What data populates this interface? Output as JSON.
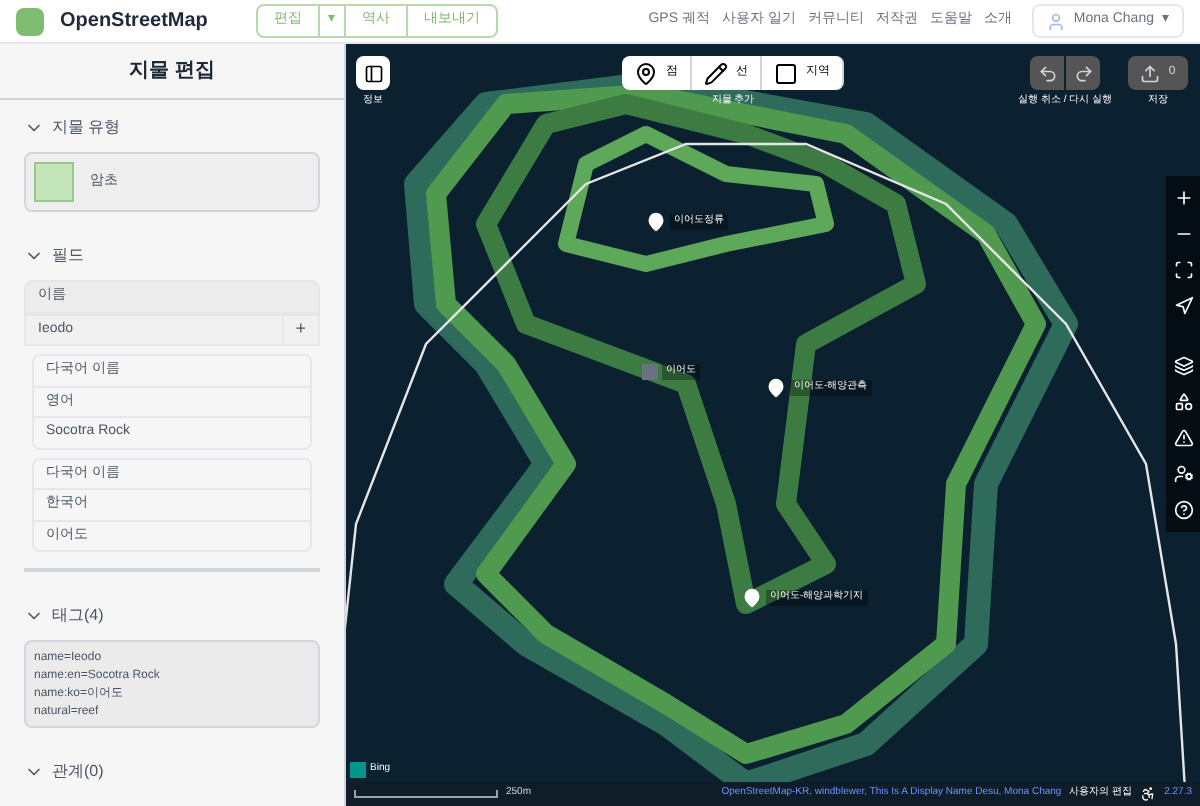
{
  "header": {
    "logo": "OpenStreetMap",
    "edit_button": "편집",
    "edit_dropdown": "▾",
    "history_button": "역사",
    "export_button": "내보내기",
    "nav_links": [
      "GPS 궤적",
      "사용자 일기",
      "커뮤니티",
      "저작권",
      "도움말",
      "소개"
    ],
    "user": "Mona Chang",
    "user_dropdown": "▾"
  },
  "sidebar": {
    "title": "지물 편집",
    "feature_type": {
      "heading": "지물 유형",
      "expanded": true,
      "preset": "암초"
    },
    "fields": {
      "heading": "필드",
      "expanded": true,
      "name_label": "이름",
      "name_value": "Ieodo",
      "add_symbol": "+",
      "multilingual": [
        {
          "label": "다국어 이름",
          "language": "영어",
          "value": "Socotra Rock"
        },
        {
          "label": "다국어 이름",
          "language": "한국어",
          "value": "이어도"
        }
      ]
    },
    "tags": {
      "heading": "태그(4)",
      "expanded": true,
      "text": "name=Ieodo\nname:en=Socotra Rock\nname:ko=이어도\nnatural=reef"
    },
    "relations": {
      "heading": "관계(0)",
      "expanded": true
    }
  },
  "map": {
    "info_label": "정보",
    "add_feature": {
      "label": "지물 추가",
      "modes": [
        {
          "kind": "point",
          "label": "점"
        },
        {
          "kind": "line",
          "label": "선"
        },
        {
          "kind": "area",
          "label": "지역"
        }
      ]
    },
    "undo_redo_label": "실행 취소 / 다시 실행",
    "save_count": "0",
    "save_label": "저장",
    "labels": [
      {
        "kind": "pin",
        "text": "이어도정류"
      },
      {
        "kind": "square",
        "text": "이어도"
      },
      {
        "kind": "pin",
        "text": "이어도-해양관측"
      },
      {
        "kind": "pin",
        "text": "이어도-해양과학기지"
      }
    ],
    "imagery": "Bing",
    "scale": "250m",
    "attribution": "OpenStreetMap-KR, windblewer, This Is A Display Name Desu, Mona Chang",
    "user_edits": "사용자의 편집",
    "version": "2.27.3"
  }
}
